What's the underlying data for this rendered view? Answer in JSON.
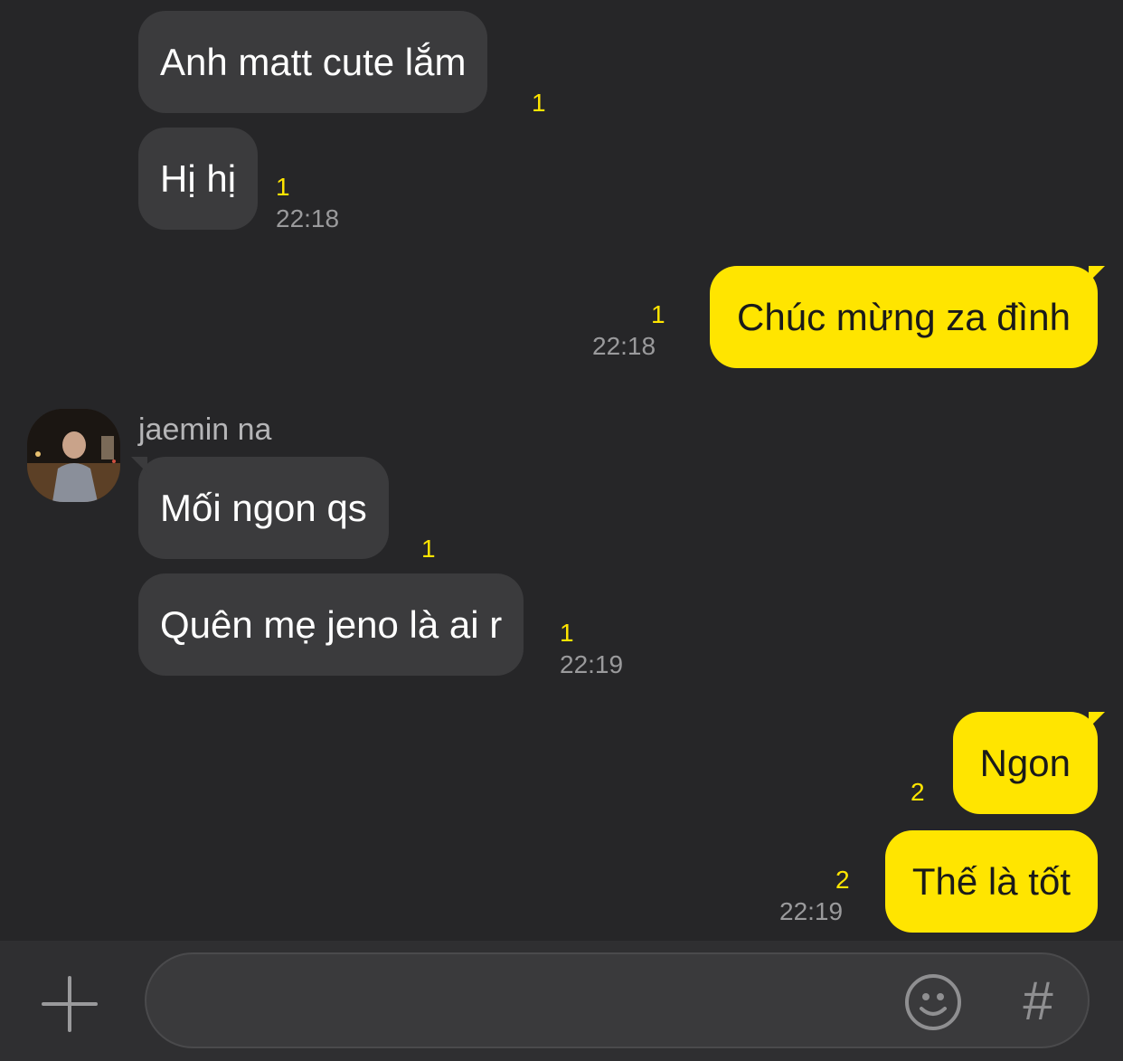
{
  "messages": [
    {
      "side": "in",
      "text": "Anh matt cute lắm",
      "unread": "1",
      "time": ""
    },
    {
      "side": "in",
      "text": "Hị hị",
      "unread": "1",
      "time": "22:18"
    },
    {
      "side": "out",
      "text": "Chúc mừng za đình",
      "unread": "1",
      "time": "22:18"
    },
    {
      "side": "in",
      "sender": "jaemin na",
      "text": "Mối ngon qs",
      "unread": "1",
      "time": ""
    },
    {
      "side": "in",
      "text": "Quên mẹ jeno là ai r",
      "unread": "1",
      "time": "22:19"
    },
    {
      "side": "out",
      "text": "Ngon",
      "unread": "2",
      "time": ""
    },
    {
      "side": "out",
      "text": "Thế là tốt",
      "unread": "2",
      "time": "22:19"
    }
  ],
  "composer": {
    "placeholder": "",
    "hash_symbol": "#"
  },
  "icons": {
    "add": "plus-icon",
    "emoji": "emoji-icon",
    "hashtag": "hashtag-icon"
  },
  "colors": {
    "background": "#262628",
    "incoming_bubble": "#3b3b3d",
    "outgoing_bubble": "#ffe500",
    "unread_count": "#ffe500",
    "timestamp": "#9a9a9c"
  }
}
